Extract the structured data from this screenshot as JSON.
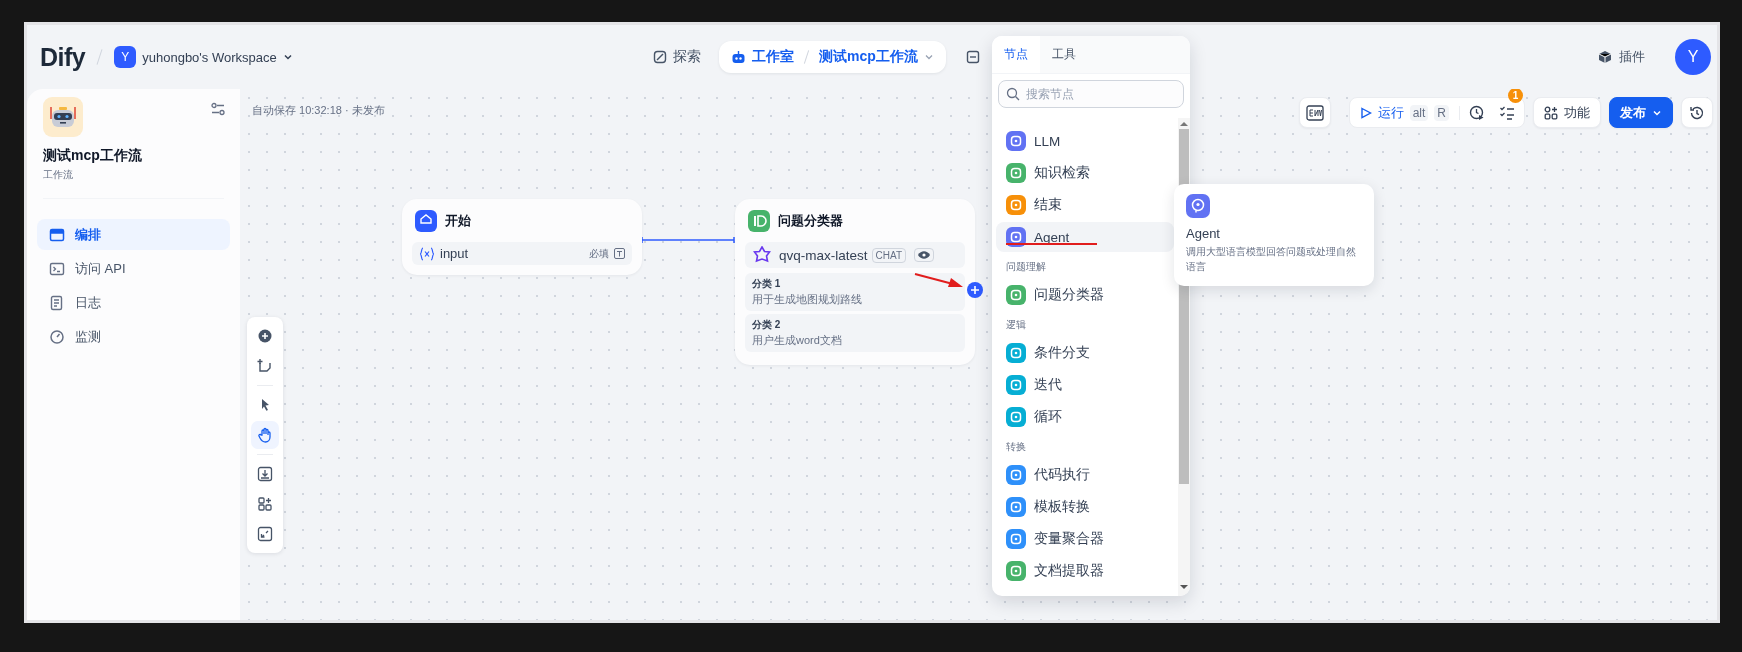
{
  "header": {
    "logo": "Dify",
    "workspace": {
      "initial": "Y",
      "name": "yuhongbo's Workspace"
    },
    "nav": [
      {
        "label": "探索",
        "selected": false
      },
      {
        "label": "工作室",
        "selected": true,
        "app": "测试mcp工作流"
      }
    ],
    "plugins": "插件",
    "avatar": "Y"
  },
  "sidebar": {
    "app_name": "测试mcp工作流",
    "app_type": "工作流",
    "items": [
      {
        "label": "编排",
        "selected": true
      },
      {
        "label": "访问 API",
        "selected": false
      },
      {
        "label": "日志",
        "selected": false
      },
      {
        "label": "监测",
        "selected": false
      }
    ]
  },
  "canvas": {
    "autosave": "自动保存 10:32:18 · 未发布",
    "tool_groups": [
      [
        {
          "kind": "add",
          "selected": false
        },
        {
          "kind": "note",
          "selected": false
        }
      ],
      [
        {
          "kind": "pointer",
          "selected": false
        },
        {
          "kind": "hand",
          "selected": true
        }
      ],
      [
        {
          "kind": "export",
          "selected": false
        },
        {
          "kind": "organize",
          "selected": false
        },
        {
          "kind": "minimap",
          "selected": false
        }
      ]
    ],
    "toolbar": {
      "run": "运行",
      "shortcut": [
        "alt",
        "R"
      ],
      "checklist_count": "1",
      "features": "功能",
      "publish": "发布"
    },
    "nodes": [
      {
        "kind": "start",
        "title": "开始",
        "variables": [
          {
            "name": "input",
            "required": "必填"
          }
        ]
      },
      {
        "kind": "classifier",
        "title": "问题分类器",
        "model": "qvq-max-latest",
        "model_mode": "CHAT",
        "classes": [
          {
            "label": "分类 1",
            "text": "用于生成地图规划路线"
          },
          {
            "label": "分类 2",
            "text": "用户生成word文档"
          }
        ],
        "annotation": {
          "kind": "arrow"
        }
      }
    ]
  },
  "block_selector": {
    "tabs": [
      {
        "label": "节点",
        "selected": true
      },
      {
        "label": "工具",
        "selected": false
      }
    ],
    "search": {
      "placeholder": "搜索节点"
    },
    "items": [
      {
        "kind": "block",
        "label": "LLM",
        "color": "#6172f3",
        "selected": false
      },
      {
        "kind": "block",
        "label": "知识检索",
        "color": "#47b36b",
        "selected": false
      },
      {
        "kind": "block",
        "label": "结束",
        "color": "#f79009",
        "selected": false
      },
      {
        "kind": "block",
        "label": "Agent",
        "color": "#6172f3",
        "selected": true,
        "annotation": {
          "kind": "underline"
        }
      },
      {
        "kind": "heading",
        "label": "问题理解"
      },
      {
        "kind": "block",
        "label": "问题分类器",
        "color": "#47b36b",
        "selected": false
      },
      {
        "kind": "heading",
        "label": "逻辑"
      },
      {
        "kind": "block",
        "label": "条件分支",
        "color": "#06aed4",
        "selected": false
      },
      {
        "kind": "block",
        "label": "迭代",
        "color": "#06aed4",
        "selected": false
      },
      {
        "kind": "block",
        "label": "循环",
        "color": "#06aed4",
        "selected": false
      },
      {
        "kind": "heading",
        "label": "转换"
      },
      {
        "kind": "block",
        "label": "代码执行",
        "color": "#2e90fa",
        "selected": false
      },
      {
        "kind": "block",
        "label": "模板转换",
        "color": "#2e90fa",
        "selected": false
      },
      {
        "kind": "block",
        "label": "变量聚合器",
        "color": "#2e90fa",
        "selected": false
      },
      {
        "kind": "block",
        "label": "文档提取器",
        "color": "#47b36b",
        "selected": false
      }
    ]
  },
  "tooltip": {
    "title": "Agent",
    "description": "调用大型语言模型回答问题或处理自然语言"
  }
}
